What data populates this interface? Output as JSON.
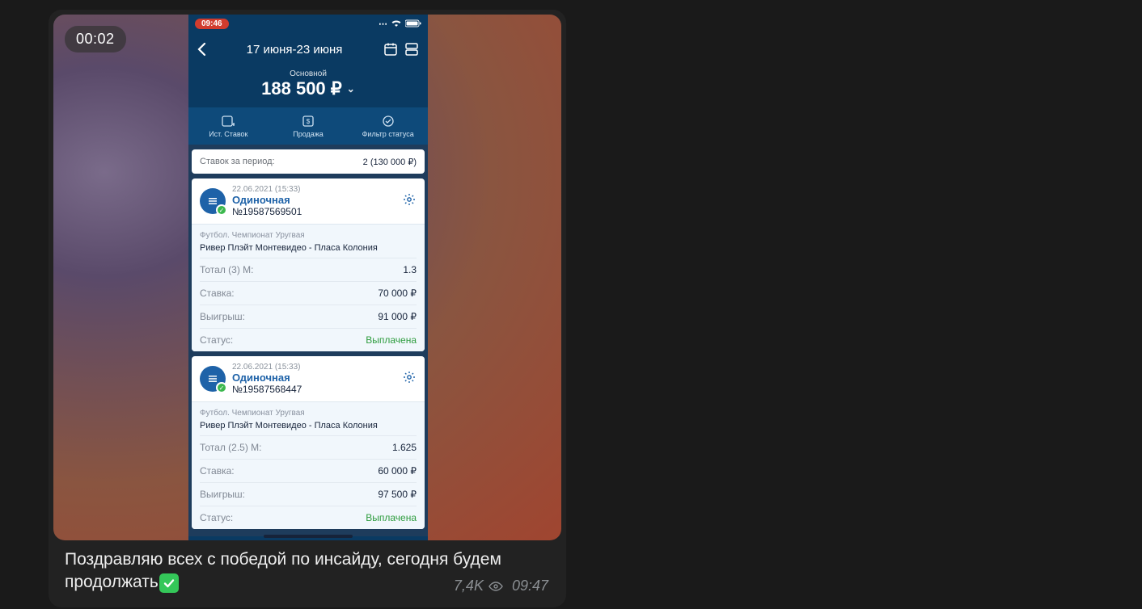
{
  "telegram": {
    "video_duration": "00:02",
    "caption": "Поздравляю всех с победой по инсайду, сегодня будем продолжать",
    "views": "7,4K",
    "time": "09:47"
  },
  "phone": {
    "status_time": "09:46",
    "date_range": "17 июня-23 июня",
    "account_label": "Основной",
    "account_amount": "188 500 ₽",
    "tabs": {
      "history": "Ист. Ставок",
      "sale": "Продажа",
      "filter": "Фильтр статуса"
    },
    "period_label": "Ставок за период:",
    "period_value": "2 (130 000 ₽)",
    "rows_k": {
      "stake": "Ставка:",
      "win": "Выигрыш:",
      "status": "Статус:"
    },
    "bets": [
      {
        "date": "22.06.2021 (15:33)",
        "type": "Одиночная",
        "number": "№19587569501",
        "league": "Футбол. Чемпионат Уругвая",
        "match": "Ривер Плэйт Монтевидео - Пласа Колония",
        "market": "Тотал (3) М:",
        "odds": "1.3",
        "stake": "70 000 ₽",
        "win": "91 000 ₽",
        "status": "Выплачена"
      },
      {
        "date": "22.06.2021 (15:33)",
        "type": "Одиночная",
        "number": "№19587568447",
        "league": "Футбол. Чемпионат Уругвая",
        "match": "Ривер Плэйт Монтевидео - Пласа Колония",
        "market": "Тотал (2.5) М:",
        "odds": "1.625",
        "stake": "60 000 ₽",
        "win": "97 500 ₽",
        "status": "Выплачена"
      }
    ]
  }
}
